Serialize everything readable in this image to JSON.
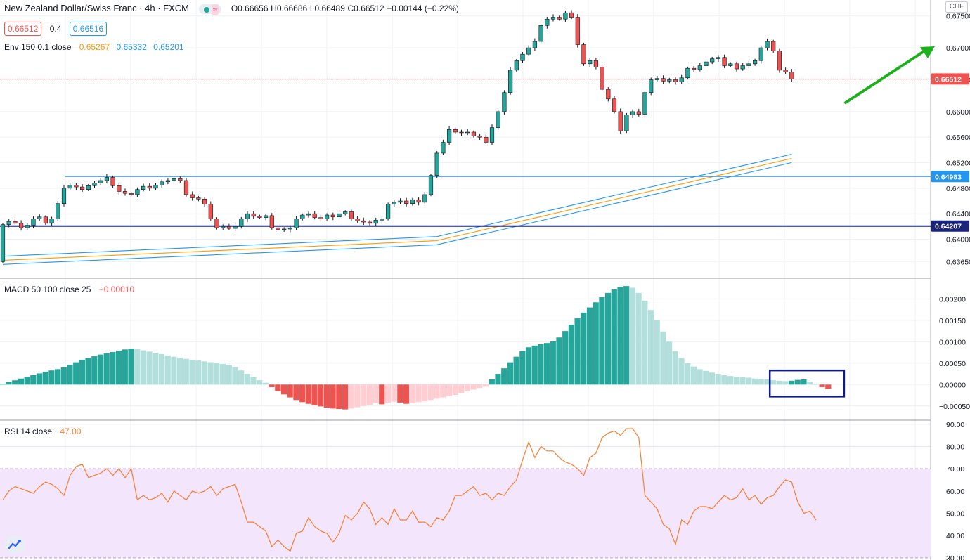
{
  "header": {
    "title": "New Zealand Dollar/Swiss Franc · 4h · FXCM",
    "open": "O0.66656",
    "high": "H0.66686",
    "low": "L0.66489",
    "close": "C0.66512",
    "change": "−0.00144 (−0.22%)",
    "bid": "0.66512",
    "spread": "0.4",
    "ask": "0.66516",
    "currency": "CHF"
  },
  "colors": {
    "up": "#26a69a",
    "down": "#ef5350",
    "up_light": "#b2dfdb",
    "down_light": "#ffcdd2",
    "env_mid": "#ff9800",
    "env_band": "#2196f3",
    "rsi_line": "#f57f30",
    "rsi_band": "#f3e5fc",
    "arrow": "#1db01d",
    "box": "#0d1a8a"
  },
  "chart_data": [
    {
      "type": "candlestick",
      "name": "main",
      "legend": {
        "label": "Env 150 0.1 close",
        "mid": "0.65267",
        "upper": "0.65332",
        "lower": "0.65201"
      },
      "ylim": [
        0.634,
        0.6775
      ],
      "y_ticks": [
        "0.67500",
        "0.67000",
        "0.66500",
        "0.66000",
        "0.65600",
        "0.65200",
        "0.64800",
        "0.64400",
        "0.64000",
        "0.63650"
      ],
      "y_tick_values": [
        0.675,
        0.67,
        0.665,
        0.66,
        0.656,
        0.652,
        0.648,
        0.644,
        0.64,
        0.6365
      ],
      "price_labels": [
        {
          "text": "0.66512",
          "value": 0.66512,
          "color": "#ef5350"
        },
        {
          "text": "0.64983",
          "value": 0.64983,
          "color": "#2196f3"
        },
        {
          "text": "0.64207",
          "value": 0.64207,
          "color": "#1a237e"
        }
      ],
      "hlines": [
        {
          "value": 0.64983,
          "color": "#2196f3",
          "start": 0.07
        },
        {
          "value": 0.64207,
          "color": "#1a237e",
          "start": 0
        }
      ],
      "close": [
        0.6423,
        0.6428,
        0.6425,
        0.6418,
        0.6422,
        0.6432,
        0.6435,
        0.6425,
        0.6432,
        0.6456,
        0.648,
        0.6485,
        0.6482,
        0.6478,
        0.6484,
        0.6488,
        0.6492,
        0.6497,
        0.6484,
        0.6475,
        0.6472,
        0.647,
        0.6478,
        0.6483,
        0.648,
        0.6485,
        0.649,
        0.6492,
        0.6495,
        0.6492,
        0.647,
        0.6465,
        0.6463,
        0.6455,
        0.6432,
        0.6418,
        0.642,
        0.6417,
        0.642,
        0.6432,
        0.644,
        0.6436,
        0.6434,
        0.6437,
        0.6418,
        0.6415,
        0.6416,
        0.6418,
        0.6432,
        0.6438,
        0.644,
        0.6434,
        0.6432,
        0.6438,
        0.6435,
        0.644,
        0.6443,
        0.6432,
        0.6429,
        0.6427,
        0.6425,
        0.643,
        0.6432,
        0.6455,
        0.6458,
        0.646,
        0.6456,
        0.6462,
        0.6458,
        0.647,
        0.65,
        0.6535,
        0.6552,
        0.6572,
        0.6568,
        0.6567,
        0.6568,
        0.6562,
        0.656,
        0.6552,
        0.6575,
        0.66,
        0.663,
        0.6665,
        0.668,
        0.669,
        0.67,
        0.671,
        0.6735,
        0.6745,
        0.6748,
        0.6745,
        0.6755,
        0.6748,
        0.6705,
        0.6675,
        0.668,
        0.667,
        0.6635,
        0.662,
        0.66,
        0.657,
        0.6595,
        0.66,
        0.6596,
        0.663,
        0.665,
        0.6652,
        0.6648,
        0.665,
        0.6647,
        0.6653,
        0.6668,
        0.6666,
        0.6672,
        0.6678,
        0.6683,
        0.6685,
        0.6672,
        0.6675,
        0.6667,
        0.6672,
        0.6675,
        0.668,
        0.67,
        0.671,
        0.6695,
        0.6665,
        0.6662,
        0.6651
      ],
      "envelope_mid_start": 0.6367,
      "envelope_mid_end": 0.65267
    },
    {
      "type": "bar",
      "name": "macd",
      "legend": {
        "label": "MACD 50 100 close 25",
        "value": "−0.00010"
      },
      "ylim": [
        -0.00075,
        0.0024
      ],
      "y_ticks": [
        "0.00200",
        "0.00150",
        "0.00100",
        "0.00050",
        "0.00000",
        "−0.00050"
      ],
      "y_tick_values": [
        0.002,
        0.0015,
        0.001,
        0.0005,
        0.0,
        -0.0005
      ],
      "values": [
        2e-05,
        6e-05,
        0.0001,
        0.00014,
        0.00018,
        0.00022,
        0.00026,
        0.0003,
        0.00033,
        0.00036,
        0.0004,
        0.00046,
        0.00052,
        0.00058,
        0.00062,
        0.00066,
        0.0007,
        0.00073,
        0.00076,
        0.00079,
        0.00082,
        0.00084,
        0.00083,
        0.0008,
        0.00077,
        0.00074,
        0.00071,
        0.00068,
        0.00065,
        0.00062,
        0.0006,
        0.00058,
        0.00056,
        0.00054,
        0.00052,
        0.0005,
        0.00048,
        0.00046,
        0.0004,
        0.00033,
        0.00025,
        0.00017,
        0.0001,
        4e-05,
        -6e-05,
        -0.00015,
        -0.00023,
        -0.0003,
        -0.00036,
        -0.00041,
        -0.00045,
        -0.00048,
        -0.00051,
        -0.00054,
        -0.00056,
        -0.00057,
        -0.00058,
        -0.00056,
        -0.00053,
        -0.0005,
        -0.00047,
        -0.00043,
        -0.00046,
        -0.00043,
        -0.0004,
        -0.00042,
        -0.00045,
        -0.00043,
        -0.00041,
        -0.00039,
        -0.00036,
        -0.00033,
        -0.0003,
        -0.00027,
        -0.00024,
        -0.0002,
        -0.00016,
        -0.00012,
        -8e-05,
        -5e-05,
        0.00012,
        0.00025,
        0.00038,
        0.00052,
        0.00065,
        0.00078,
        0.00087,
        0.00091,
        0.00094,
        0.00097,
        0.00101,
        0.0011,
        0.00125,
        0.0014,
        0.00155,
        0.00168,
        0.0018,
        0.00192,
        0.00204,
        0.00214,
        0.00222,
        0.00228,
        0.0023,
        0.00226,
        0.00214,
        0.00196,
        0.00174,
        0.0015,
        0.00124,
        0.001,
        0.00078,
        0.00062,
        0.0005,
        0.00042,
        0.00036,
        0.00032,
        0.00028,
        0.00025,
        0.00022,
        0.0002,
        0.00018,
        0.00017,
        0.00016,
        0.00014,
        0.00013,
        0.00012,
        0.0001,
        9e-05,
        8e-05,
        9e-05,
        0.00011,
        0.00012,
        7e-05,
        2e-05,
        -6e-05,
        -0.0001
      ],
      "annotation_box": {
        "from_index": 126,
        "to_index": 137,
        "top": 0.00033,
        "bottom": -0.00028
      }
    },
    {
      "type": "line",
      "name": "rsi",
      "legend": {
        "label": "RSI 14 close",
        "value": "47.00"
      },
      "ylim": [
        29.0,
        91.5
      ],
      "band": [
        30,
        70
      ],
      "y_ticks": [
        "90.00",
        "80.00",
        "70.00",
        "60.00",
        "50.00",
        "40.00",
        "30.00"
      ],
      "y_tick_values": [
        90,
        80,
        70,
        60,
        50,
        40,
        30
      ],
      "values": [
        56,
        60,
        62,
        61,
        60,
        59,
        62,
        64,
        63,
        61,
        58,
        67,
        71,
        72,
        66,
        67,
        68,
        70,
        67,
        70,
        66,
        70,
        56,
        58,
        56,
        57,
        59,
        55,
        60,
        58,
        56,
        60,
        59,
        60,
        62,
        58,
        61,
        62,
        63,
        55,
        46,
        46,
        44,
        42,
        35,
        38,
        35,
        33,
        41,
        42,
        48,
        44,
        42,
        41,
        37,
        41,
        49,
        47,
        50,
        55,
        52,
        45,
        48,
        45,
        52,
        47,
        47,
        51,
        46,
        46,
        44,
        48,
        47,
        51,
        58,
        58,
        60,
        62,
        58,
        59,
        56,
        59,
        58,
        62,
        65,
        74,
        82,
        75,
        80,
        78,
        78,
        75,
        73,
        72,
        70,
        67,
        75,
        77,
        84,
        86,
        87,
        85,
        88,
        88,
        84,
        58,
        55,
        52,
        45,
        43,
        36,
        47,
        45,
        51,
        53,
        53,
        52,
        55,
        58,
        56,
        57,
        61,
        56,
        58,
        54,
        57,
        58,
        62,
        65,
        64,
        55,
        50,
        51,
        47
      ],
      "band_color": "#f3e5fc"
    }
  ]
}
